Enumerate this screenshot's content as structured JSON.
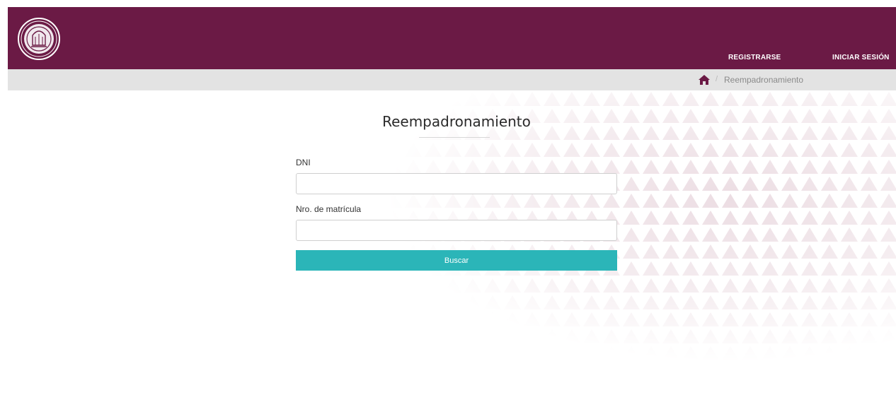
{
  "header": {
    "logo": "institution-seal-logo",
    "nav": {
      "register_label": "REGISTRARSE",
      "login_label": "INICIAR SESIÓN"
    },
    "colors": {
      "background": "#6b1a45",
      "text": "#ffffff"
    }
  },
  "breadcrumb": {
    "home_icon": "home-icon",
    "separator": "/",
    "current": "Reempadronamiento"
  },
  "form": {
    "title": "Reempadronamiento",
    "dni": {
      "label": "DNI",
      "value": "",
      "placeholder": ""
    },
    "matricula": {
      "label": "Nro. de matrícula",
      "value": "",
      "placeholder": ""
    },
    "submit_label": "Buscar",
    "accent_color": "#2bb5b8"
  }
}
